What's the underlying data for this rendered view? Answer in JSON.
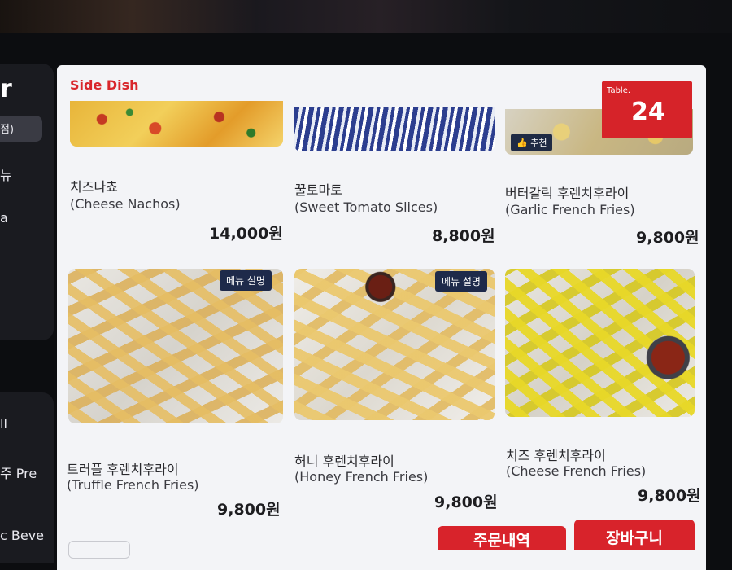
{
  "sidebar": {
    "logo_fragment": "r",
    "items": [
      {
        "label": "점)"
      },
      {
        "label": "뉴"
      },
      {
        "label": "a"
      },
      {
        "label": "ll"
      },
      {
        "label": "주 Pre"
      },
      {
        "label": "c Beve"
      }
    ]
  },
  "section": {
    "title": "Side Dish"
  },
  "table": {
    "label": "Table.",
    "number": "24"
  },
  "tags": {
    "menu_info": "메뉴 설명",
    "recommended": "추천"
  },
  "products": [
    {
      "name_ko": "치즈나쵸",
      "name_en": "(Cheese Nachos)",
      "price": "14,000원"
    },
    {
      "name_ko": "꿀토마토",
      "name_en": "(Sweet Tomato Slices)",
      "price": "8,800원"
    },
    {
      "name_ko": "버터갈릭 후렌치후라이",
      "name_en": "(Garlic French Fries)",
      "price": "9,800원"
    },
    {
      "name_ko": "트러플 후렌치후라이",
      "name_en": "(Truffle French Fries)",
      "price": "9,800원"
    },
    {
      "name_ko": "허니 후렌치후라이",
      "name_en": "(Honey French Fries)",
      "price": "9,800원"
    },
    {
      "name_ko": "치즈 후렌치후라이",
      "name_en": "(Cheese French Fries)",
      "price": "9,800원"
    }
  ],
  "footer": {
    "order_history": "주문내역",
    "cart": "장바구니"
  }
}
